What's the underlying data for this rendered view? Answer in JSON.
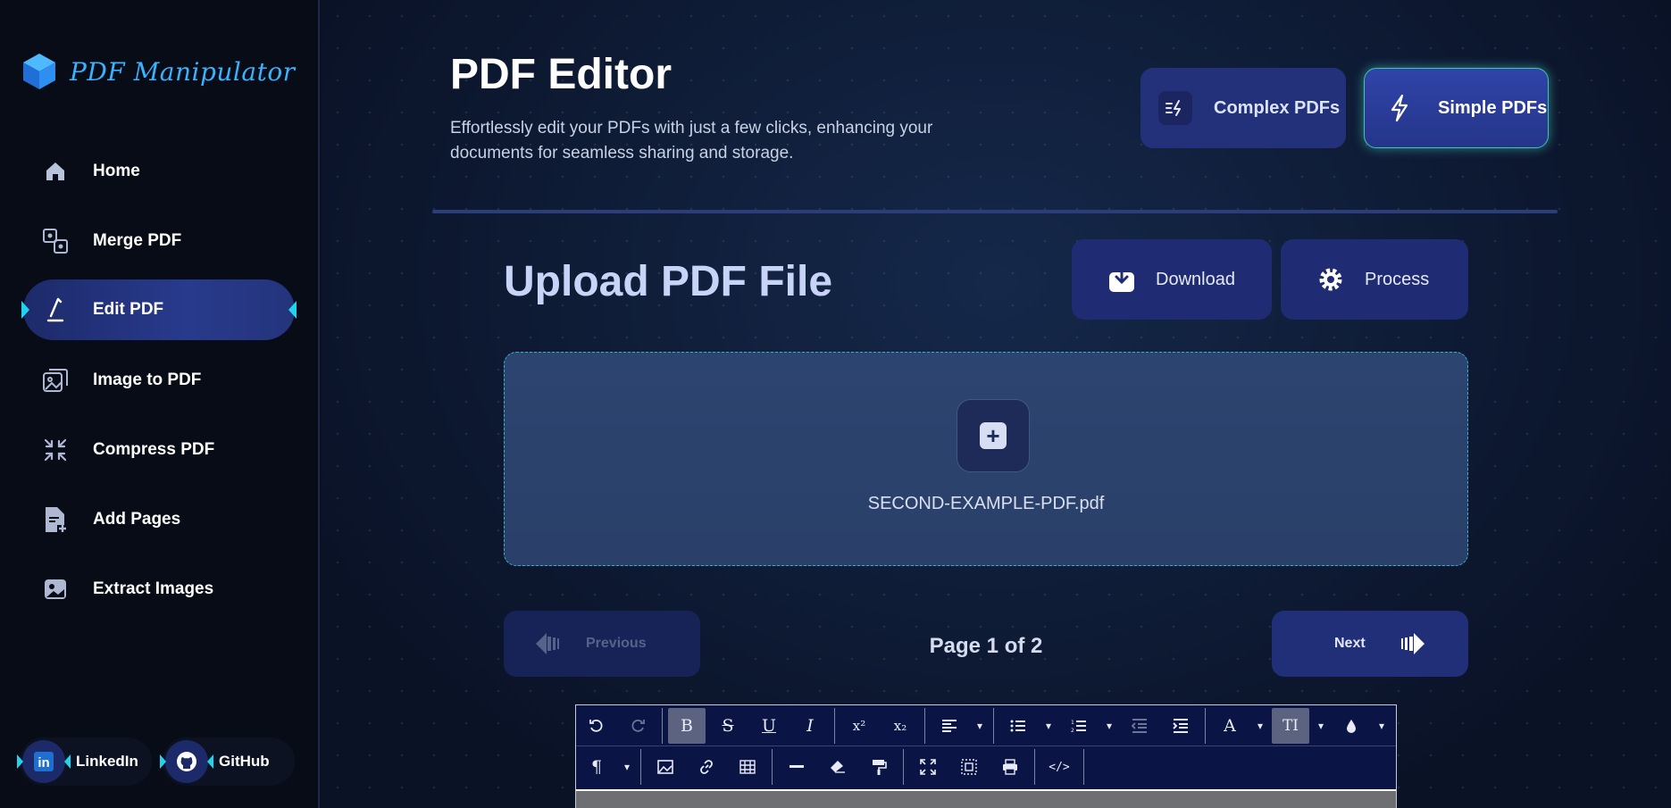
{
  "app": {
    "name": "PDF Manipulator",
    "brand_color": "#37b3ff"
  },
  "sidebar": {
    "items": [
      {
        "label": "Home",
        "icon": "home-icon"
      },
      {
        "label": "Merge PDF",
        "icon": "merge-icon"
      },
      {
        "label": "Edit PDF",
        "icon": "pen-icon",
        "active": true
      },
      {
        "label": "Image to PDF",
        "icon": "images-icon"
      },
      {
        "label": "Compress PDF",
        "icon": "compress-icon"
      },
      {
        "label": "Add Pages",
        "icon": "file-plus-icon"
      },
      {
        "label": "Extract Images",
        "icon": "image-icon"
      }
    ],
    "social": [
      {
        "label": "LinkedIn",
        "icon": "linkedin-icon"
      },
      {
        "label": "GitHub",
        "icon": "github-icon"
      }
    ]
  },
  "header": {
    "title": "PDF Editor",
    "subtitle": "Effortlessly edit your PDFs with just a few clicks, enhancing your documents for seamless sharing and storage.",
    "modes": [
      {
        "label": "Complex PDFs",
        "icon": "bolt-lines-icon"
      },
      {
        "label": "Simple PDFs",
        "icon": "bolt-icon",
        "selected": true
      }
    ]
  },
  "upload": {
    "title": "Upload PDF File",
    "download_label": "Download",
    "process_label": "Process",
    "file_name": "SECOND-EXAMPLE-PDF.pdf",
    "add_icon": "+"
  },
  "pager": {
    "previous_label": "Previous",
    "next_label": "Next",
    "page_info": "Page 1 of 2"
  },
  "editor": {
    "toolbar_row1": [
      "undo",
      "redo",
      "bold",
      "strikethrough",
      "underline",
      "italic",
      "superscript",
      "subscript",
      "align",
      "bullet-list",
      "numbered-list",
      "outdent",
      "indent",
      "font-color",
      "text-size",
      "highlight"
    ],
    "toolbar_row2": [
      "paragraph",
      "image",
      "link",
      "table",
      "horizontal-rule",
      "eraser",
      "format-painter",
      "fullscreen",
      "select-all",
      "print",
      "code-view"
    ],
    "glyphs": {
      "bold": "B",
      "strike": "S",
      "underline": "U",
      "italic": "I",
      "sup": "x²",
      "sub": "x₂",
      "font": "A",
      "size": "TI",
      "para": "¶",
      "code": "</>"
    }
  }
}
